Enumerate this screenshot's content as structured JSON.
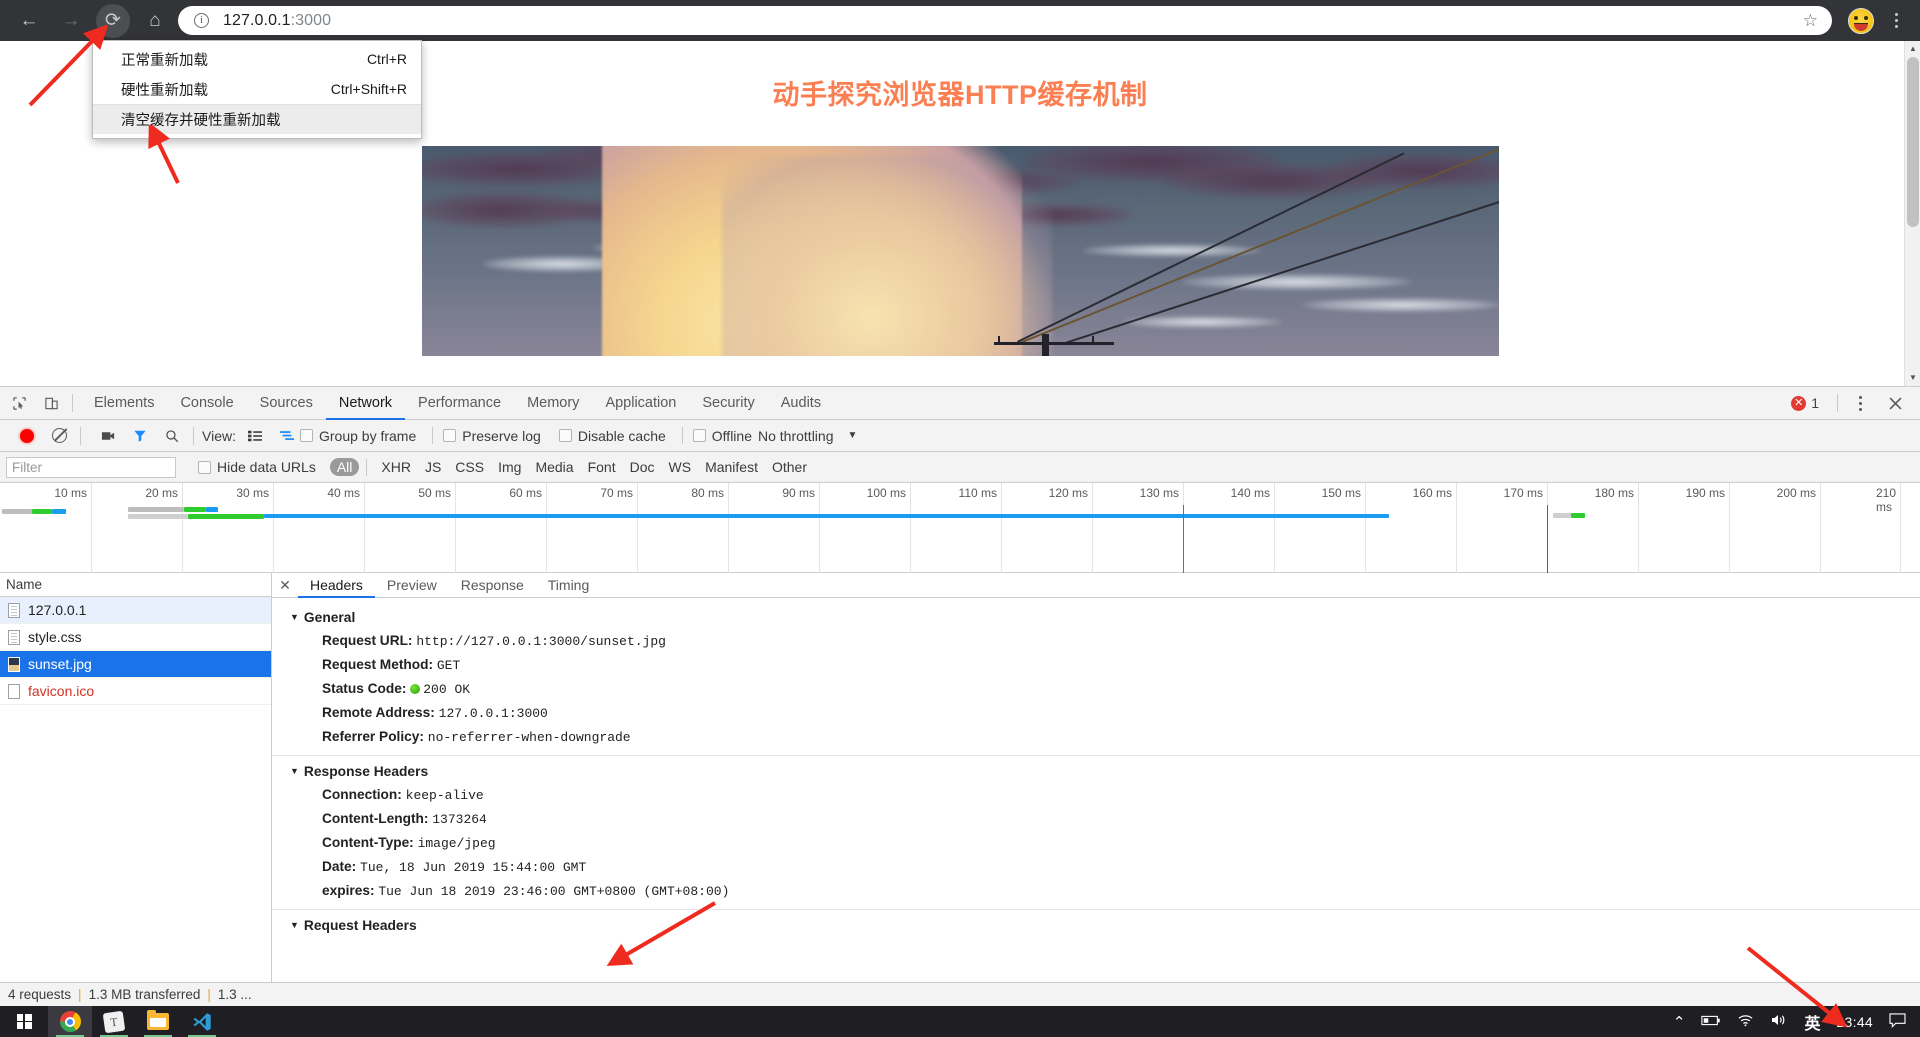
{
  "browser": {
    "nav": {
      "back": "←",
      "forward": "→",
      "reload": "⟳",
      "home": "⌂"
    },
    "url": "127.0.0.1",
    "url_port": ":3000",
    "star_icon": "☆",
    "info_icon": "i"
  },
  "context_menu": {
    "items": [
      {
        "label": "正常重新加载",
        "shortcut": "Ctrl+R",
        "selected": false
      },
      {
        "label": "硬性重新加载",
        "shortcut": "Ctrl+Shift+R",
        "selected": false
      },
      {
        "label": "清空缓存并硬性重新加载",
        "shortcut": "",
        "selected": true
      }
    ]
  },
  "page": {
    "title": "动手探究浏览器HTTP缓存机制",
    "title_color": "#fb7f52",
    "image_alt": "sunset.jpg"
  },
  "devtools": {
    "tabs": [
      {
        "label": "Elements",
        "active": false
      },
      {
        "label": "Console",
        "active": false
      },
      {
        "label": "Sources",
        "active": false
      },
      {
        "label": "Network",
        "active": true
      },
      {
        "label": "Performance",
        "active": false
      },
      {
        "label": "Memory",
        "active": false
      },
      {
        "label": "Application",
        "active": false
      },
      {
        "label": "Security",
        "active": false
      },
      {
        "label": "Audits",
        "active": false
      }
    ],
    "error_count": "1",
    "toolbar": {
      "view_label": "View:",
      "group_by_frame": "Group by frame",
      "preserve_log": "Preserve log",
      "disable_cache": "Disable cache",
      "offline": "Offline",
      "throttling": "No throttling"
    },
    "filterbar": {
      "filter_placeholder": "Filter",
      "hide_data_urls": "Hide data URLs",
      "types": [
        "All",
        "XHR",
        "JS",
        "CSS",
        "Img",
        "Media",
        "Font",
        "Doc",
        "WS",
        "Manifest",
        "Other"
      ],
      "active_type": "All"
    },
    "timeline": {
      "ticks": [
        "10 ms",
        "20 ms",
        "30 ms",
        "40 ms",
        "50 ms",
        "60 ms",
        "70 ms",
        "80 ms",
        "90 ms",
        "100 ms",
        "110 ms",
        "120 ms",
        "130 ms",
        "140 ms",
        "150 ms",
        "160 ms",
        "170 ms",
        "180 ms",
        "190 ms",
        "200 ms",
        "210 ms"
      ],
      "dom_content_loaded_ms": 130,
      "load_event_ms": 168
    },
    "requests": {
      "column_header": "Name",
      "rows": [
        {
          "name": "127.0.0.1",
          "icon": "document-icon",
          "state": "highlight"
        },
        {
          "name": "style.css",
          "icon": "document-icon",
          "state": "normal"
        },
        {
          "name": "sunset.jpg",
          "icon": "image-icon",
          "state": "selected"
        },
        {
          "name": "favicon.ico",
          "icon": "document-icon",
          "state": "error"
        }
      ]
    },
    "detail_tabs": [
      {
        "label": "Headers",
        "active": true
      },
      {
        "label": "Preview",
        "active": false
      },
      {
        "label": "Response",
        "active": false
      },
      {
        "label": "Timing",
        "active": false
      }
    ],
    "general": {
      "section": "General",
      "rows": [
        {
          "name": "Request URL:",
          "value": "http://127.0.0.1:3000/sunset.jpg"
        },
        {
          "name": "Request Method:",
          "value": "GET"
        },
        {
          "name": "Status Code:",
          "value": "200 OK",
          "dot": true
        },
        {
          "name": "Remote Address:",
          "value": "127.0.0.1:3000"
        },
        {
          "name": "Referrer Policy:",
          "value": "no-referrer-when-downgrade"
        }
      ]
    },
    "response_headers": {
      "section": "Response Headers",
      "rows": [
        {
          "name": "Connection:",
          "value": "keep-alive"
        },
        {
          "name": "Content-Length:",
          "value": "1373264"
        },
        {
          "name": "Content-Type:",
          "value": "image/jpeg"
        },
        {
          "name": "Date:",
          "value": "Tue, 18 Jun 2019 15:44:00 GMT"
        },
        {
          "name": "expires:",
          "value": "Tue Jun 18 2019 23:46:00 GMT+0800 (GMT+08:00)"
        }
      ]
    },
    "request_headers_section": "Request Headers",
    "status": {
      "requests": "4 requests",
      "transferred": "1.3 MB transferred",
      "resources": "1.3 ..."
    }
  },
  "taskbar": {
    "apps": [
      "chrome",
      "sticky-notes",
      "file-explorer",
      "vscode"
    ],
    "tray": {
      "chevron": "⌃",
      "battery": "battery-icon",
      "wifi": "wifi-icon",
      "volume": "volume-icon",
      "ime": "英",
      "clock": "23:44",
      "notifications": "notification-icon"
    }
  }
}
